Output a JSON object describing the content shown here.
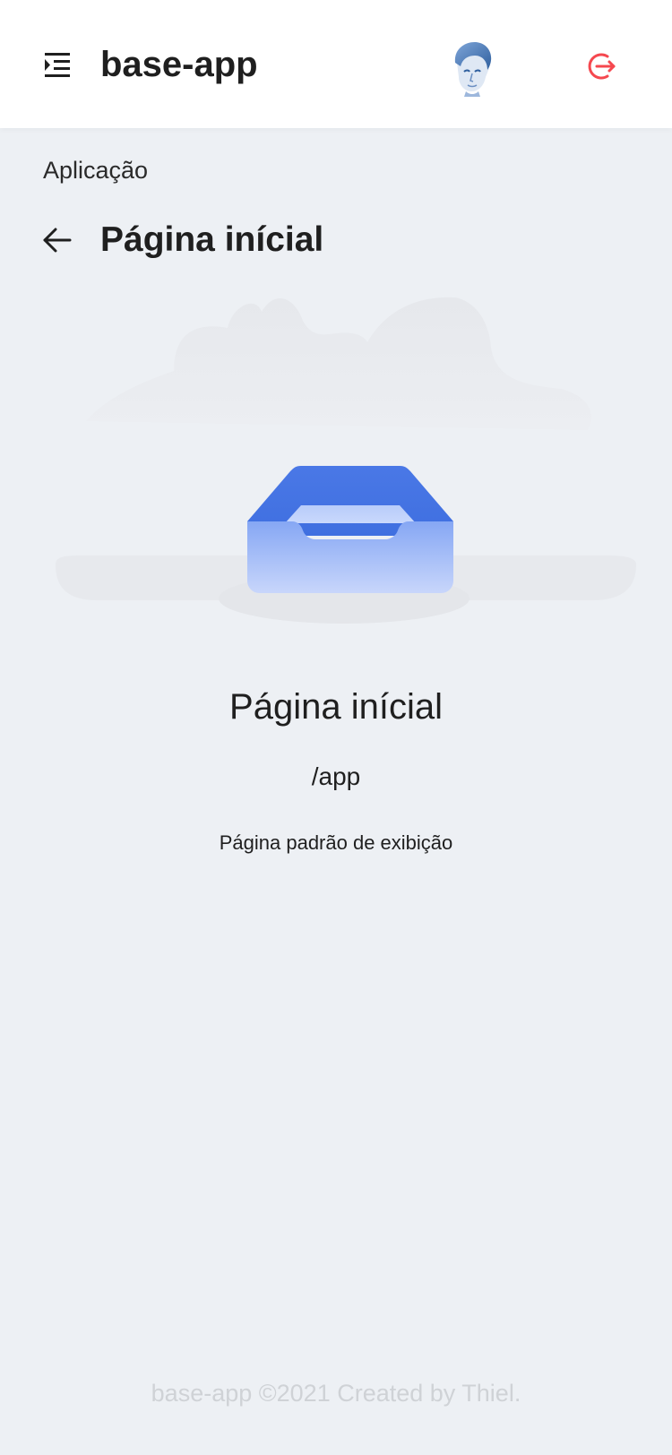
{
  "header": {
    "menu_icon": "menu-unfold-icon",
    "app_title": "base-app",
    "avatar": "user-avatar",
    "logout_icon": "logout-icon",
    "logout_color": "#f5484f"
  },
  "breadcrumb": {
    "label": "Aplicação"
  },
  "page_header": {
    "back_icon": "arrow-left-icon",
    "title": "Página inícial"
  },
  "empty_state": {
    "illustration": "empty-inbox-tray",
    "title": "Página inícial",
    "subtitle": "/app",
    "description": "Página padrão de exibição"
  },
  "footer": {
    "text": "base-app ©2021 Created by Thiel."
  },
  "colors": {
    "background": "#edf0f4",
    "header_bg": "#ffffff",
    "accent_blue": "#4c7be9",
    "danger_red": "#f5484f",
    "footer_text": "#cfd2d6"
  }
}
